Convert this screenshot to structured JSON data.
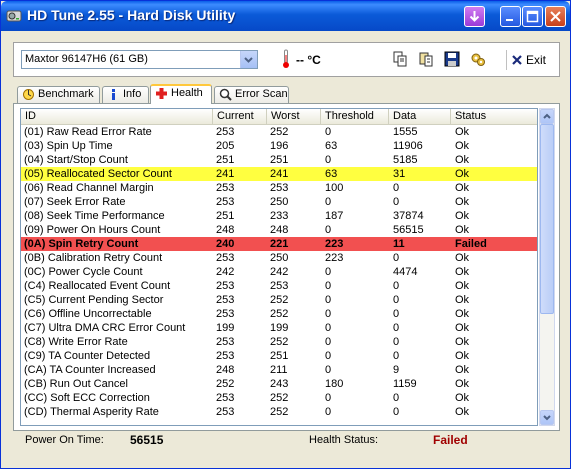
{
  "window": {
    "title": "HD Tune 2.55 - Hard Disk Utility"
  },
  "toolbar": {
    "drive": "Maxtor 96147H6 (61 GB)",
    "temperature": "-- °C",
    "exit_label": "Exit"
  },
  "tabs": [
    {
      "label": "Benchmark",
      "active": false
    },
    {
      "label": "Info",
      "active": false
    },
    {
      "label": "Health",
      "active": true
    },
    {
      "label": "Error Scan",
      "active": false
    }
  ],
  "table": {
    "headers": [
      "ID",
      "Current",
      "Worst",
      "Threshold",
      "Data",
      "Status"
    ],
    "rows": [
      {
        "id": "(01) Raw Read Error Rate",
        "current": "253",
        "worst": "252",
        "threshold": "0",
        "data": "1555",
        "status": "Ok",
        "highlight": ""
      },
      {
        "id": "(03) Spin Up Time",
        "current": "205",
        "worst": "196",
        "threshold": "63",
        "data": "11906",
        "status": "Ok",
        "highlight": ""
      },
      {
        "id": "(04) Start/Stop Count",
        "current": "251",
        "worst": "251",
        "threshold": "0",
        "data": "5185",
        "status": "Ok",
        "highlight": ""
      },
      {
        "id": "(05) Reallocated Sector Count",
        "current": "241",
        "worst": "241",
        "threshold": "63",
        "data": "31",
        "status": "Ok",
        "highlight": "warn"
      },
      {
        "id": "(06) Read Channel Margin",
        "current": "253",
        "worst": "253",
        "threshold": "100",
        "data": "0",
        "status": "Ok",
        "highlight": ""
      },
      {
        "id": "(07) Seek Error Rate",
        "current": "253",
        "worst": "250",
        "threshold": "0",
        "data": "0",
        "status": "Ok",
        "highlight": ""
      },
      {
        "id": "(08) Seek Time Performance",
        "current": "251",
        "worst": "233",
        "threshold": "187",
        "data": "37874",
        "status": "Ok",
        "highlight": ""
      },
      {
        "id": "(09) Power On Hours Count",
        "current": "248",
        "worst": "248",
        "threshold": "0",
        "data": "56515",
        "status": "Ok",
        "highlight": ""
      },
      {
        "id": "(0A) Spin Retry Count",
        "current": "240",
        "worst": "221",
        "threshold": "223",
        "data": "11",
        "status": "Failed",
        "highlight": "fail"
      },
      {
        "id": "(0B) Calibration Retry Count",
        "current": "253",
        "worst": "250",
        "threshold": "223",
        "data": "0",
        "status": "Ok",
        "highlight": ""
      },
      {
        "id": "(0C) Power Cycle Count",
        "current": "242",
        "worst": "242",
        "threshold": "0",
        "data": "4474",
        "status": "Ok",
        "highlight": ""
      },
      {
        "id": "(C4) Reallocated Event Count",
        "current": "253",
        "worst": "253",
        "threshold": "0",
        "data": "0",
        "status": "Ok",
        "highlight": ""
      },
      {
        "id": "(C5) Current Pending Sector",
        "current": "253",
        "worst": "252",
        "threshold": "0",
        "data": "0",
        "status": "Ok",
        "highlight": ""
      },
      {
        "id": "(C6) Offline Uncorrectable",
        "current": "253",
        "worst": "252",
        "threshold": "0",
        "data": "0",
        "status": "Ok",
        "highlight": ""
      },
      {
        "id": "(C7) Ultra DMA CRC Error Count",
        "current": "199",
        "worst": "199",
        "threshold": "0",
        "data": "0",
        "status": "Ok",
        "highlight": ""
      },
      {
        "id": "(C8) Write Error Rate",
        "current": "253",
        "worst": "252",
        "threshold": "0",
        "data": "0",
        "status": "Ok",
        "highlight": ""
      },
      {
        "id": "(C9) TA Counter Detected",
        "current": "253",
        "worst": "251",
        "threshold": "0",
        "data": "0",
        "status": "Ok",
        "highlight": ""
      },
      {
        "id": "(CA) TA Counter Increased",
        "current": "248",
        "worst": "211",
        "threshold": "0",
        "data": "9",
        "status": "Ok",
        "highlight": ""
      },
      {
        "id": "(CB) Run Out Cancel",
        "current": "252",
        "worst": "243",
        "threshold": "180",
        "data": "1159",
        "status": "Ok",
        "highlight": ""
      },
      {
        "id": "(CC) Soft ECC Correction",
        "current": "253",
        "worst": "252",
        "threshold": "0",
        "data": "0",
        "status": "Ok",
        "highlight": ""
      },
      {
        "id": "(CD) Thermal Asperity Rate",
        "current": "253",
        "worst": "252",
        "threshold": "0",
        "data": "0",
        "status": "Ok",
        "highlight": ""
      }
    ]
  },
  "status_bar": {
    "power_on_label": "Power On Time:",
    "power_on_value": "56515",
    "health_label": "Health Status:",
    "health_value": "Failed"
  },
  "colors": {
    "warn": "#ffff40",
    "fail": "#f25050",
    "failed_text": "#a00000",
    "titlebar": "#0b5ad8"
  },
  "icons": [
    "hdd-app-icon",
    "download-icon",
    "minimize-icon",
    "maximize-icon",
    "close-icon",
    "thermometer-icon",
    "copy-icon",
    "copy-all-icon",
    "save-icon",
    "options-icon",
    "exit-x-icon",
    "benchmark-icon",
    "info-icon",
    "health-cross-icon",
    "error-scan-icon"
  ]
}
